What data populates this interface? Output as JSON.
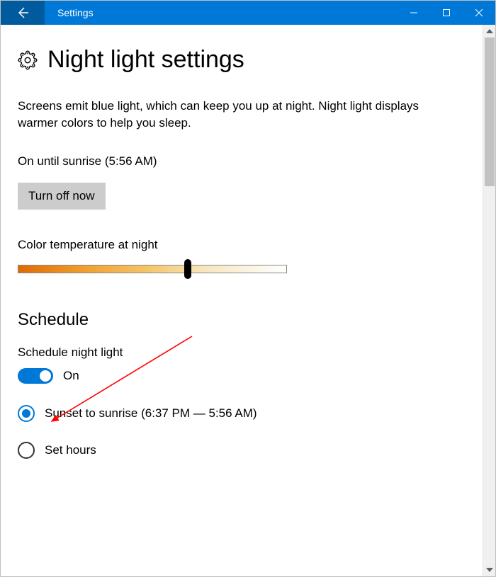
{
  "titlebar": {
    "title": "Settings"
  },
  "page": {
    "heading": "Night light settings",
    "description": "Screens emit blue light, which can keep you up at night. Night light displays warmer colors to help you sleep.",
    "status": "On until sunrise (5:56 AM)",
    "turn_off_label": "Turn off now",
    "slider_label": "Color temperature at night"
  },
  "schedule": {
    "heading": "Schedule",
    "toggle_label": "Schedule night light",
    "toggle_state": "On",
    "option_sunset": "Sunset to sunrise (6:37 PM — 5:56 AM)",
    "option_set_hours": "Set hours"
  }
}
